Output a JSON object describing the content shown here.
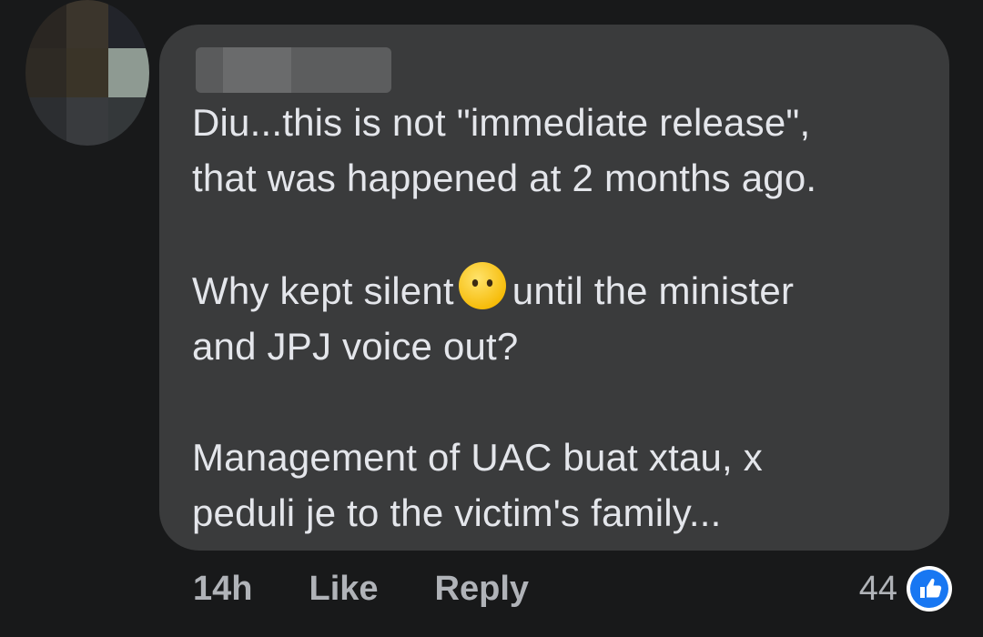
{
  "comment": {
    "author_name": "",
    "paragraphs": [
      {
        "lines": [
          "Diu...this is not \"immediate release\",",
          "that was happened at 2 months ago."
        ]
      },
      {
        "lines": [
          "Why kept silent",
          "and JPJ voice out?"
        ],
        "emoji": "face-without-mouth-emoji",
        "emoji_after": "until the minister"
      },
      {
        "lines": [
          "Management of UAC buat xtau, x",
          "peduli je to the victim's family..."
        ]
      }
    ]
  },
  "actions": {
    "time": "14h",
    "like_label": "Like",
    "reply_label": "Reply"
  },
  "reactions": {
    "count": "44",
    "type": "like-icon",
    "color": "#1877f2"
  },
  "colors": {
    "background": "#18191a",
    "bubble": "#3a3b3c",
    "text": "#e4e6eb",
    "secondary_text": "#b0b3b8"
  }
}
